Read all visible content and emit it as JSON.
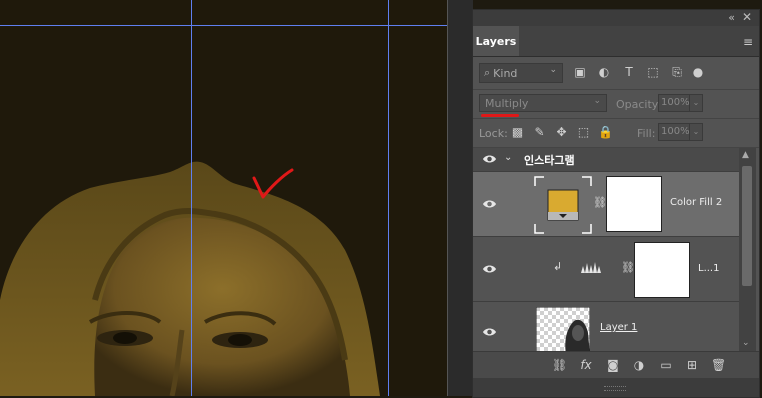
{
  "panel": {
    "collapse_icon": "«",
    "close_icon": "✕",
    "tab_label": "Layers",
    "menu_icon": "≡"
  },
  "filter": {
    "kind_label": "Kind",
    "icons": [
      "image-filter-icon",
      "adjustment-filter-icon",
      "type-filter-icon",
      "shape-filter-icon",
      "smart-object-filter-icon",
      "filter-toggle-icon"
    ]
  },
  "blend": {
    "mode": "Multiply",
    "opacity_label": "Opacity:",
    "opacity_value": "100%"
  },
  "lock": {
    "label": "Lock:",
    "fill_label": "Fill:",
    "fill_value": "100%"
  },
  "layers": {
    "group_name": "인스타그램",
    "items": [
      {
        "name": "Color Fill 2",
        "selected": true,
        "fill_color": "#d9aa30"
      },
      {
        "name": "L...1",
        "selected": false
      },
      {
        "name": "Layer 1",
        "selected": false
      }
    ]
  },
  "colors": {
    "canvas_bg": "#1f190b",
    "guide": "#5f7ff0",
    "annotation_red": "#e01818",
    "panel_bg": "#535353",
    "selected_row": "#6d6d6d"
  },
  "bottom_icons": [
    "link-layers-icon",
    "fx-icon",
    "add-mask-icon",
    "new-adjustment-icon",
    "new-group-icon",
    "new-layer-icon",
    "delete-layer-icon"
  ]
}
